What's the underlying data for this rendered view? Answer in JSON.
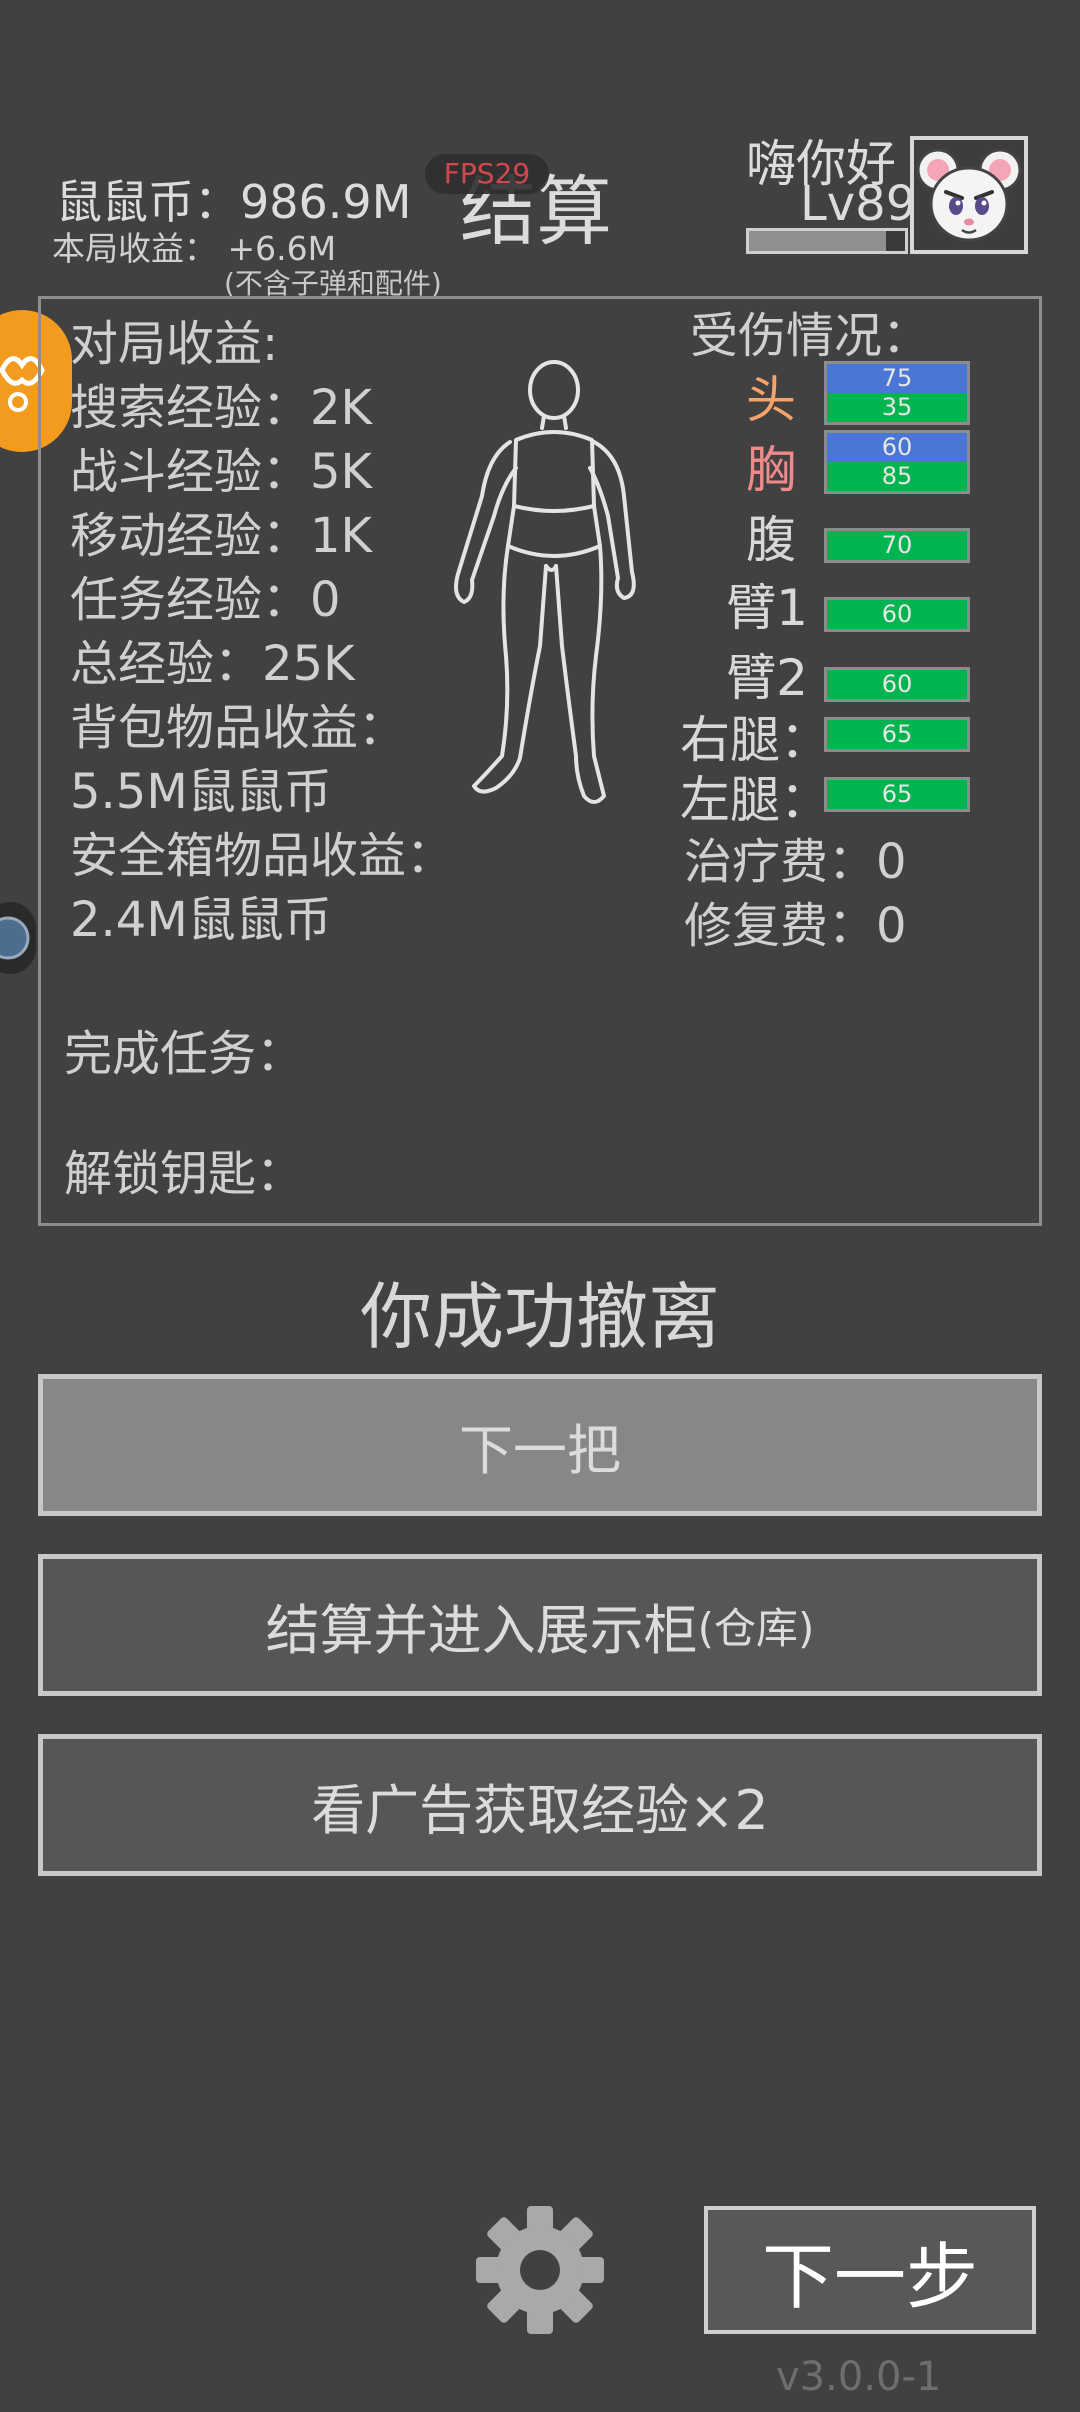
{
  "header": {
    "coins_label": "鼠鼠币：986.9M",
    "income_label": "本局收益： +6.6M",
    "income_note": "(不含子弹和配件)",
    "title": "结算",
    "fps": "FPS29"
  },
  "player": {
    "name": "嗨你好",
    "level": "Lv89",
    "xp_fraction": 0.88
  },
  "earnings": {
    "heading": "对局收益:",
    "search_exp": "搜索经验：2K",
    "combat_exp": "战斗经验：5K",
    "move_exp": "移动经验：1K",
    "task_exp": "任务经验：0",
    "total_exp": "总经验：25K",
    "backpack_label": "背包物品收益：",
    "backpack_value": "5.5M鼠鼠币",
    "safebox_label": "安全箱物品收益：",
    "safebox_value": "2.4M鼠鼠币",
    "tasks_label": "完成任务：",
    "keys_label": "解锁钥匙："
  },
  "injury": {
    "heading": "受伤情况：",
    "parts": [
      {
        "label": "头",
        "color": "#f5a36b",
        "armor": "75",
        "hp": "35"
      },
      {
        "label": "胸",
        "color": "#ef8a8a",
        "armor": "60",
        "hp": "85"
      },
      {
        "label": "腹",
        "color": "#d8d8d8",
        "hp": "70"
      },
      {
        "label": "臂1",
        "color": "#d8d8d8",
        "hp": "60"
      },
      {
        "label": "臂2",
        "color": "#d8d8d8",
        "hp": "60"
      },
      {
        "label": "右腿：",
        "color": "#d8d8d8",
        "hp": "65"
      },
      {
        "label": "左腿：",
        "color": "#d8d8d8",
        "hp": "65"
      }
    ],
    "heal_fee": "治疗费：0",
    "repair_fee": "修复费：0"
  },
  "result": {
    "message": "你成功撤离"
  },
  "buttons": {
    "next_round": "下一把",
    "settle_showcase": "结算并进入展示柜",
    "settle_showcase_suffix": "(仓库)",
    "ad_exp": "看广告获取经验×2",
    "next_step": "下一步"
  },
  "footer": {
    "version": "v3.0.0-1"
  },
  "icons": {
    "settings": "gear-icon",
    "side_orange": "orange-side-badge-icon",
    "side_blue": "blue-side-badge-icon"
  },
  "colors": {
    "background": "#414141",
    "armor_bar": "#4a76d6",
    "hp_bar": "#00b44f",
    "fps_text": "#e0484f"
  }
}
